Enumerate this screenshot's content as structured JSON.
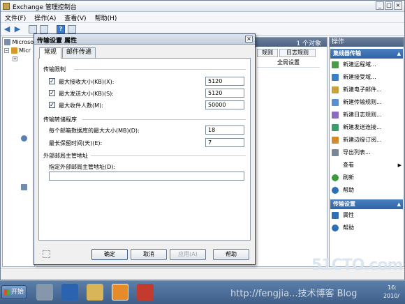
{
  "window": {
    "title": "Exchange 管理控制台",
    "controls": [
      "_",
      "□",
      "×"
    ]
  },
  "menubar": [
    {
      "label": "文件(F)"
    },
    {
      "label": "操作(A)"
    },
    {
      "label": "查看(V)"
    },
    {
      "label": "帮助(H)"
    }
  ],
  "toolbar": {
    "back_icon": "back-arrow-icon",
    "forward_icon": "forward-arrow-icon",
    "help_label": "?"
  },
  "tree": {
    "items": [
      {
        "label": "Microso"
      },
      {
        "label": "Micr"
      }
    ]
  },
  "center": {
    "object_count": "1 个对象",
    "tabs": [
      {
        "label": "规则"
      },
      {
        "label": "日志规则"
      }
    ],
    "column": "全局设置"
  },
  "actions": {
    "title": "操作",
    "sections": [
      {
        "title": "集线器传输",
        "items": [
          {
            "label": "新建远程域...",
            "icon": "domain-icon",
            "color": "#4c9a4a"
          },
          {
            "label": "新建接受域...",
            "icon": "accepted-domain-icon",
            "color": "#3c7fc4"
          },
          {
            "label": "新建电子邮件...",
            "icon": "email-icon",
            "color": "#c7a23a"
          },
          {
            "label": "新建传输规则...",
            "icon": "transport-rule-icon",
            "color": "#5a8fcf"
          },
          {
            "label": "新建日志规则...",
            "icon": "journal-rule-icon",
            "color": "#8a6cc0"
          },
          {
            "label": "新建发送连接...",
            "icon": "send-connector-icon",
            "color": "#3d9b6b"
          },
          {
            "label": "新建边缘订阅...",
            "icon": "edge-subscription-icon",
            "color": "#d18b2c"
          },
          {
            "label": "导出列表...",
            "icon": "export-list-icon",
            "color": "#7a8797"
          },
          {
            "label": "查看",
            "icon": "",
            "color": "",
            "submenu": "▶"
          },
          {
            "label": "刷新",
            "icon": "refresh-icon",
            "color": "#3d9b3d"
          },
          {
            "label": "帮助",
            "icon": "help-icon",
            "color": "#2f6fb8"
          }
        ]
      },
      {
        "title": "传输设置",
        "items": [
          {
            "label": "属性",
            "icon": "properties-icon",
            "color": "#2f6fb8"
          },
          {
            "label": "帮助",
            "icon": "help-icon",
            "color": "#2f6fb8"
          }
        ]
      }
    ]
  },
  "dialog": {
    "title": "传输设置 属性",
    "close_label": "×",
    "tabs": [
      {
        "label": "常规"
      },
      {
        "label": "邮件传递"
      }
    ],
    "limits_group": "传输限制",
    "limits": [
      {
        "label": "最大接收大小(KB)(X):",
        "checked": true,
        "value": "5120"
      },
      {
        "label": "最大发送大小(KB)(S):",
        "checked": true,
        "value": "5120"
      },
      {
        "label": "最大收件人数(M):",
        "checked": true,
        "value": "50000"
      }
    ],
    "dumpster_group": "传输转储程序",
    "dumpster": [
      {
        "label": "每个邮箱数据库的最大大小(MB)(D):",
        "value": "18"
      },
      {
        "label": "最长保留时间(天)(E):",
        "value": "7"
      }
    ],
    "postmaster_group": "外部邮局主管地址",
    "postmaster_label": "指定外部邮局主管地址(D):",
    "postmaster_value": "",
    "buttons": {
      "ok": "确定",
      "cancel": "取消",
      "apply": "应用(A)",
      "help": "帮助"
    }
  },
  "taskbar": {
    "start_label": "开始",
    "time": "16:",
    "date": "2010/"
  },
  "watermark": {
    "line1": "51CTO.com",
    "line2": "http://fengjia...技术博客 Blog"
  }
}
